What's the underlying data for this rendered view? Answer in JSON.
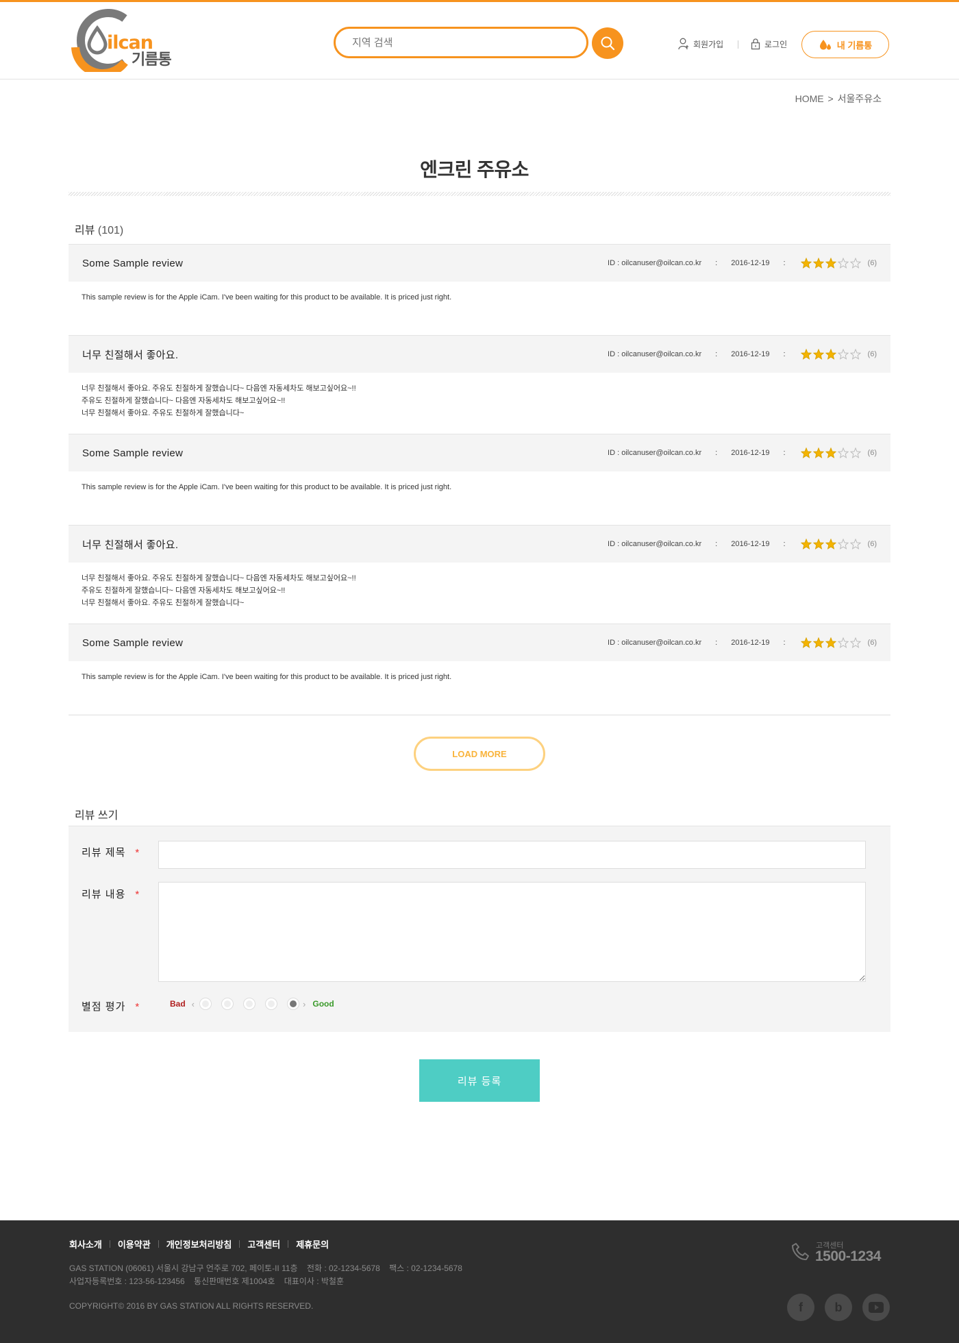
{
  "colors": {
    "brand": "#f7931e",
    "accent_teal": "#4ecdc4",
    "star": "#f5b400",
    "footer_bg": "#2e2e2e"
  },
  "header": {
    "logo_text": "ilcan",
    "logo_sub": "기름통",
    "search_placeholder": "지역 검색",
    "signup_label": "회원가입",
    "login_label": "로그인",
    "my_tank_label": "내 기름통"
  },
  "breadcrumb": {
    "home": "HOME",
    "sep": ">",
    "current": "서울주유소"
  },
  "page_title": "엔크린 주유소",
  "reviews_section": {
    "title": "리뷰",
    "count": "(101)"
  },
  "reviews": [
    {
      "title": "Some Sample review",
      "id": "ID : oilcanuser@oilcan.co.kr",
      "sep": ":",
      "date": "2016-12-19",
      "rating": 3,
      "count": "(6)",
      "body": [
        "This sample review is for the Apple iCam. I've been waiting for this product to be available. It is priced just right."
      ]
    },
    {
      "title": "너무 친절해서 좋아요.",
      "id": "ID : oilcanuser@oilcan.co.kr",
      "sep": ":",
      "date": "2016-12-19",
      "rating": 3,
      "count": "(6)",
      "body": [
        "너무 친절해서 좋아요. 주유도 친절하게 잘했습니다~ 다음엔 자동세차도 해보고싶어요~!!",
        "주유도 친절하게 잘했습니다~ 다음엔 자동세차도 해보고싶어요~!!",
        "너무 친절해서 좋아요. 주유도 친절하게 잘했습니다~"
      ]
    },
    {
      "title": "Some Sample review",
      "id": "ID : oilcanuser@oilcan.co.kr",
      "sep": ":",
      "date": "2016-12-19",
      "rating": 3,
      "count": "(6)",
      "body": [
        "This sample review is for the Apple iCam. I've been waiting for this product to be available. It is priced just right."
      ]
    },
    {
      "title": "너무 친절해서 좋아요.",
      "id": "ID : oilcanuser@oilcan.co.kr",
      "sep": ":",
      "date": "2016-12-19",
      "rating": 3,
      "count": "(6)",
      "body": [
        "너무 친절해서 좋아요. 주유도 친절하게 잘했습니다~ 다음엔 자동세차도 해보고싶어요~!!",
        "주유도 친절하게 잘했습니다~ 다음엔 자동세차도 해보고싶어요~!!",
        "너무 친절해서 좋아요. 주유도 친절하게 잘했습니다~"
      ]
    },
    {
      "title": "Some Sample review",
      "id": "ID : oilcanuser@oilcan.co.kr",
      "sep": ":",
      "date": "2016-12-19",
      "rating": 3,
      "count": "(6)",
      "body": [
        "This sample review is for the Apple iCam. I've been waiting for this product to be available. It is priced just right."
      ]
    }
  ],
  "load_more_label": "LOAD MORE",
  "write": {
    "section_title": "리뷰 쓰기",
    "title_label": "리뷰 제목",
    "content_label": "리뷰 내용",
    "rating_label": "별점 평가",
    "required_mark": "*",
    "title_value": "",
    "content_value": "",
    "bad_label": "Bad",
    "good_label": "Good",
    "selected_rating": 5,
    "submit_label": "리뷰 등록"
  },
  "footer": {
    "links": [
      "회사소개",
      "이용약관",
      "개인정보처리방침",
      "고객센터",
      "제휴문의"
    ],
    "address": "GAS STATION (06061) 서울시 강남구 언주로 702, 페이토-II 11층    전화 : 02-1234-5678    팩스 : 02-1234-5678",
    "business": "사업자등록번호 : 123-56-123456    통신판매번호 제1004호    대표이사 : 박철훈",
    "copyright": "COPYRIGHT© 2016 BY GAS STATION ALL RIGHTS RESERVED.",
    "cs_label": "고객센터",
    "cs_phone": "1500-1234",
    "social": [
      "facebook-icon",
      "blog-icon",
      "youtube-icon"
    ]
  }
}
